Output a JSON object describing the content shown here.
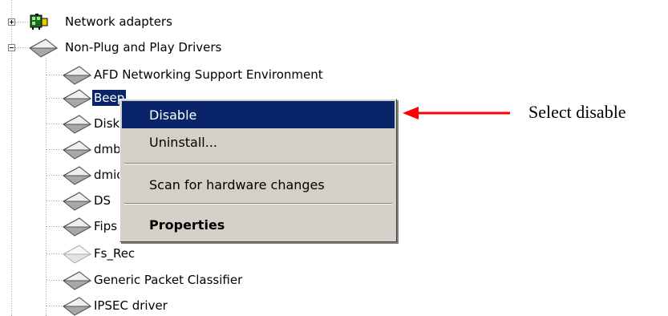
{
  "tree": {
    "categories": [
      {
        "label": "Network adapters",
        "icon": "network-adapter-icon",
        "expander": "+"
      },
      {
        "label": "Non-Plug and Play Drivers",
        "icon": "driver-diamond-icon",
        "expander": "-"
      }
    ],
    "drivers": [
      {
        "label": "AFD Networking Support Environment",
        "icon": "driver-diamond-icon"
      },
      {
        "label": "Beep",
        "icon": "driver-diamond-icon",
        "selected": true
      },
      {
        "label": "Disk",
        "icon": "driver-diamond-icon"
      },
      {
        "label": "dmboot",
        "icon": "driver-diamond-icon"
      },
      {
        "label": "dmio",
        "icon": "driver-diamond-icon"
      },
      {
        "label": "DS",
        "icon": "driver-diamond-icon"
      },
      {
        "label": "Fips",
        "icon": "driver-diamond-icon"
      },
      {
        "label": "Fs_Rec",
        "icon": "driver-diamond-disabled-icon"
      },
      {
        "label": "Generic Packet Classifier",
        "icon": "driver-diamond-icon"
      },
      {
        "label": "IPSEC driver",
        "icon": "driver-diamond-icon"
      }
    ]
  },
  "context_menu": {
    "items": [
      {
        "label": "Disable",
        "highlighted": true
      },
      {
        "label": "Uninstall..."
      },
      {
        "label": "Scan for hardware changes"
      },
      {
        "label": "Properties",
        "bold": true
      }
    ]
  },
  "annotation": {
    "text": "Select disable",
    "arrow_color": "#ff0000"
  },
  "colors": {
    "selection": "#0a246a",
    "menu_background": "#d4d0c8"
  }
}
